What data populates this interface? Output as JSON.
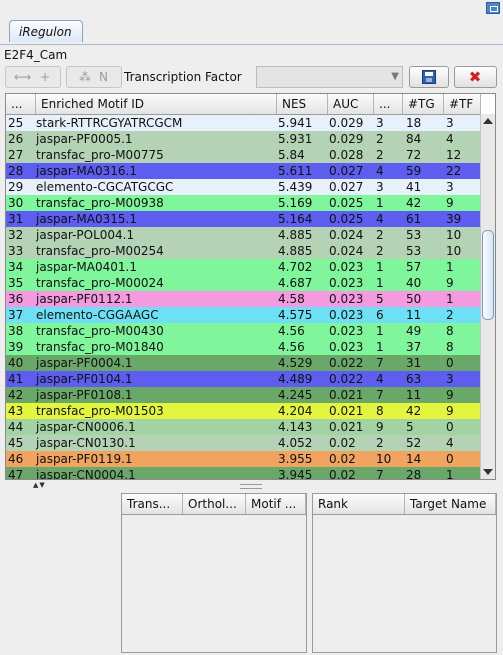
{
  "window": {
    "restore_icon": "restore-window-icon"
  },
  "tab": {
    "label": "iRegulon"
  },
  "subtitle": "E2F4_Cam",
  "toolbar": {
    "add_button_label": "+",
    "network_button_label": "N",
    "tf_label": "Transcription Factor",
    "tf_value": "",
    "save_icon": "floppy-disk-icon",
    "close_icon": "red-x-icon"
  },
  "table": {
    "headers": [
      "...",
      "Enriched Motif ID",
      "NES",
      "AUC",
      "...",
      "#TG",
      "#TF"
    ],
    "rows": [
      {
        "rank": "25",
        "motif": "stark-RTTRCGYATRCGCM",
        "nes": "5.941",
        "auc": "0.029",
        "cl": "3",
        "tg": "18",
        "tf": "3",
        "bg": "#e6f1fb"
      },
      {
        "rank": "26",
        "motif": "jaspar-PF0005.1",
        "nes": "5.931",
        "auc": "0.029",
        "cl": "2",
        "tg": "84",
        "tf": "4",
        "bg": "#b4d2b4"
      },
      {
        "rank": "27",
        "motif": "transfac_pro-M00775",
        "nes": "5.84",
        "auc": "0.028",
        "cl": "2",
        "tg": "72",
        "tf": "12",
        "bg": "#b4d2b4"
      },
      {
        "rank": "28",
        "motif": "jaspar-MA0316.1",
        "nes": "5.611",
        "auc": "0.027",
        "cl": "4",
        "tg": "59",
        "tf": "22",
        "bg": "#5d5df0"
      },
      {
        "rank": "29",
        "motif": "elemento-CGCATGCGC",
        "nes": "5.439",
        "auc": "0.027",
        "cl": "3",
        "tg": "41",
        "tf": "3",
        "bg": "#e6f1fb"
      },
      {
        "rank": "30",
        "motif": "transfac_pro-M00938",
        "nes": "5.169",
        "auc": "0.025",
        "cl": "1",
        "tg": "42",
        "tf": "9",
        "bg": "#7ff59c"
      },
      {
        "rank": "31",
        "motif": "jaspar-MA0315.1",
        "nes": "5.164",
        "auc": "0.025",
        "cl": "4",
        "tg": "61",
        "tf": "39",
        "bg": "#5d5df0"
      },
      {
        "rank": "32",
        "motif": "jaspar-POL004.1",
        "nes": "4.885",
        "auc": "0.024",
        "cl": "2",
        "tg": "53",
        "tf": "10",
        "bg": "#b4d2b4"
      },
      {
        "rank": "33",
        "motif": "transfac_pro-M00254",
        "nes": "4.885",
        "auc": "0.024",
        "cl": "2",
        "tg": "53",
        "tf": "10",
        "bg": "#b4d2b4"
      },
      {
        "rank": "34",
        "motif": "jaspar-MA0401.1",
        "nes": "4.702",
        "auc": "0.023",
        "cl": "1",
        "tg": "57",
        "tf": "1",
        "bg": "#7ff59c"
      },
      {
        "rank": "35",
        "motif": "transfac_pro-M00024",
        "nes": "4.687",
        "auc": "0.023",
        "cl": "1",
        "tg": "40",
        "tf": "9",
        "bg": "#7ff59c"
      },
      {
        "rank": "36",
        "motif": "jaspar-PF0112.1",
        "nes": "4.58",
        "auc": "0.023",
        "cl": "5",
        "tg": "50",
        "tf": "1",
        "bg": "#f59ae0"
      },
      {
        "rank": "37",
        "motif": "elemento-CGGAAGC",
        "nes": "4.575",
        "auc": "0.023",
        "cl": "6",
        "tg": "11",
        "tf": "2",
        "bg": "#6ee0f5"
      },
      {
        "rank": "38",
        "motif": "transfac_pro-M00430",
        "nes": "4.56",
        "auc": "0.023",
        "cl": "1",
        "tg": "49",
        "tf": "8",
        "bg": "#7ff59c"
      },
      {
        "rank": "39",
        "motif": "transfac_pro-M01840",
        "nes": "4.56",
        "auc": "0.023",
        "cl": "1",
        "tg": "37",
        "tf": "8",
        "bg": "#7ff59c"
      },
      {
        "rank": "40",
        "motif": "jaspar-PF0004.1",
        "nes": "4.529",
        "auc": "0.022",
        "cl": "7",
        "tg": "31",
        "tf": "0",
        "bg": "#6aa86a"
      },
      {
        "rank": "41",
        "motif": "jaspar-PF0104.1",
        "nes": "4.489",
        "auc": "0.022",
        "cl": "4",
        "tg": "63",
        "tf": "3",
        "bg": "#5d5df0"
      },
      {
        "rank": "42",
        "motif": "jaspar-PF0108.1",
        "nes": "4.245",
        "auc": "0.021",
        "cl": "7",
        "tg": "11",
        "tf": "9",
        "bg": "#6aa86a"
      },
      {
        "rank": "43",
        "motif": "transfac_pro-M01503",
        "nes": "4.204",
        "auc": "0.021",
        "cl": "8",
        "tg": "42",
        "tf": "9",
        "bg": "#e3f53c"
      },
      {
        "rank": "44",
        "motif": "jaspar-CN0006.1",
        "nes": "4.143",
        "auc": "0.021",
        "cl": "9",
        "tg": "5",
        "tf": "0",
        "bg": "#a3d2a3"
      },
      {
        "rank": "45",
        "motif": "jaspar-CN0130.1",
        "nes": "4.052",
        "auc": "0.02",
        "cl": "2",
        "tg": "52",
        "tf": "4",
        "bg": "#b4d2b4"
      },
      {
        "rank": "46",
        "motif": "jaspar-PF0119.1",
        "nes": "3.955",
        "auc": "0.02",
        "cl": "10",
        "tg": "14",
        "tf": "0",
        "bg": "#f0a45f"
      },
      {
        "rank": "47",
        "motif": "jaspar-CN0004.1",
        "nes": "3.945",
        "auc": "0.02",
        "cl": "7",
        "tg": "28",
        "tf": "1",
        "bg": "#6aa86a"
      }
    ]
  },
  "bottom_left": {
    "headers": [
      "Trans...",
      "Orthol...",
      "Motif ..."
    ]
  },
  "bottom_right": {
    "headers": [
      "Rank",
      "Target Name"
    ]
  }
}
